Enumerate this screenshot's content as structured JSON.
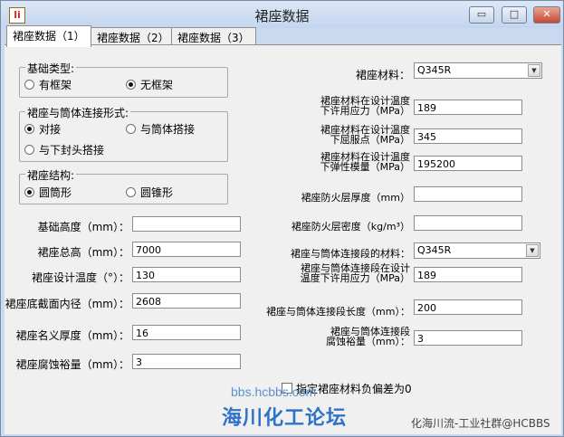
{
  "window": {
    "title": "裙座数据",
    "icon": "app-icon",
    "icon_glyph": "li",
    "controls": {
      "minimize": "▭",
      "restore": "□",
      "close": "✕"
    }
  },
  "tabs": [
    {
      "label": "裙座数据（1）",
      "active": true
    },
    {
      "label": "裙座数据（2）",
      "active": false
    },
    {
      "label": "裙座数据（3）",
      "active": false
    }
  ],
  "foundation_type": {
    "legend": "基础类型:",
    "options": [
      {
        "label": "有框架",
        "checked": false
      },
      {
        "label": "无框架",
        "checked": true
      }
    ]
  },
  "connection_form": {
    "legend": "裙座与筒体连接形式:",
    "options": [
      {
        "label": "对接",
        "checked": true
      },
      {
        "label": "与筒体搭接",
        "checked": false
      },
      {
        "label": "与下封头搭接",
        "checked": false
      }
    ]
  },
  "skirt_structure": {
    "legend": "裙座结构:",
    "options": [
      {
        "label": "圆筒形",
        "checked": true
      },
      {
        "label": "圆锥形",
        "checked": false
      }
    ]
  },
  "left_fields": [
    {
      "label": "基础高度（mm）：",
      "value": ""
    },
    {
      "label": "裙座总高（mm）：",
      "value": "7000"
    },
    {
      "label": "裙座设计温度（°）：",
      "value": "130"
    },
    {
      "label": "裙座底截面内径（mm）：",
      "value": "2608"
    },
    {
      "label": "裙座名义厚度（mm）：",
      "value": "16"
    },
    {
      "label": "裙座腐蚀裕量（mm）：",
      "value": "3"
    }
  ],
  "right": {
    "material": {
      "label": "裙座材料：",
      "value": "Q345R"
    },
    "allowable_stress": {
      "line1": "裙座材料在设计温度",
      "line2": "下许用应力（MPa）",
      "value": "189"
    },
    "yield_point": {
      "line1": "裙座材料在设计温度",
      "line2": "下屈服点（MPa）",
      "value": "345"
    },
    "elastic_modulus": {
      "line1": "裙座材料在设计温度",
      "line2": "下弹性模量（MPa）",
      "value": "195200"
    },
    "fireproof_thickness": {
      "label": "裙座防火层厚度（mm）",
      "value": ""
    },
    "fireproof_density": {
      "label": "裙座防火层密度（kg/m³）",
      "value": ""
    },
    "connection_material": {
      "label": "裙座与筒体连接段的材料：",
      "value": "Q345R"
    },
    "connection_allowable_stress": {
      "line1": "裙座与筒体连接段在设计",
      "line2": "温度下许用应力（MPa）",
      "value": "189"
    },
    "connection_length": {
      "label": "裙座与筒体连接段长度（mm）：",
      "value": "200"
    },
    "connection_corrosion": {
      "line1": "裙座与筒体连接段",
      "line2": "腐蚀裕量（mm）：",
      "value": "3"
    }
  },
  "negative_deviation_checkbox": {
    "label": "指定裙座材料负偏差为0",
    "checked": false
  },
  "watermark": {
    "url": "bbs.hcbbs.com",
    "forum": "海川化工论坛",
    "corner": "化海川流-工业社群@HCBBS"
  }
}
